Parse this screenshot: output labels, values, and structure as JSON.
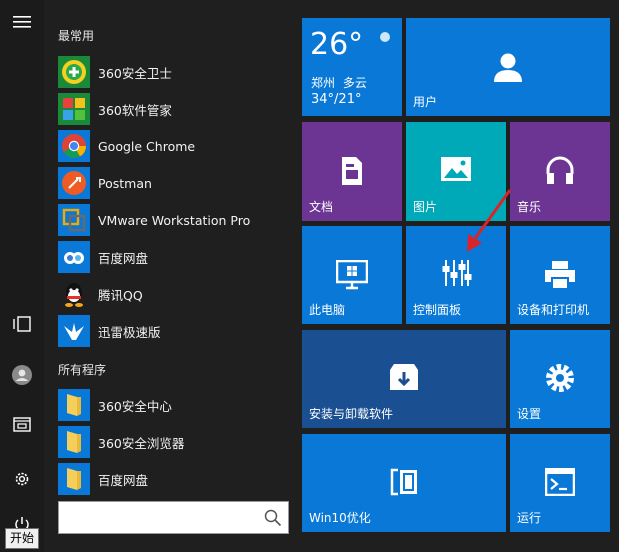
{
  "colors": {
    "background": "#1f1f1f",
    "tile_blue": "#0a78d7",
    "tile_purple": "#6c3493",
    "tile_teal": "#00a9b8",
    "tile_dark_blue": "#1a4f92",
    "arrow": "#d9242a"
  },
  "left_rail": {
    "items": [
      {
        "icon": "hamburger-menu-icon"
      },
      {
        "icon": "tablet-mode-icon"
      },
      {
        "icon": "user-avatar-icon"
      },
      {
        "icon": "documents-icon"
      },
      {
        "icon": "gear-icon"
      },
      {
        "icon": "power-icon"
      }
    ]
  },
  "sections": {
    "most_used": "最常用",
    "all_programs": "所有程序"
  },
  "most_used_apps": [
    {
      "name": "360安全卫士",
      "icon": "360-security-icon"
    },
    {
      "name": "360软件管家",
      "icon": "360-software-manager-icon"
    },
    {
      "name": "Google Chrome",
      "icon": "chrome-icon"
    },
    {
      "name": "Postman",
      "icon": "postman-icon"
    },
    {
      "name": "VMware Workstation Pro",
      "icon": "vmware-icon"
    },
    {
      "name": "百度网盘",
      "icon": "baidu-netdisk-icon"
    },
    {
      "name": "腾讯QQ",
      "icon": "qq-icon"
    },
    {
      "name": "迅雷极速版",
      "icon": "thunder-icon"
    }
  ],
  "all_programs_apps": [
    {
      "name": "360安全中心",
      "icon": "folder-icon"
    },
    {
      "name": "360安全浏览器",
      "icon": "folder-icon"
    },
    {
      "name": "百度网盘",
      "icon": "folder-icon"
    }
  ],
  "search": {
    "placeholder": "",
    "icon": "search-icon"
  },
  "tooltip": {
    "text": "开始"
  },
  "tiles": {
    "weather": {
      "temp": "26°",
      "city": "郑州",
      "condition": "多云",
      "range": "34°/21°"
    },
    "user": {
      "label": "用户",
      "icon": "user-icon"
    },
    "documents": {
      "label": "文档",
      "icon": "document-icon"
    },
    "pictures": {
      "label": "图片",
      "icon": "picture-icon"
    },
    "music": {
      "label": "音乐",
      "icon": "headphones-icon"
    },
    "this_pc": {
      "label": "此电脑",
      "icon": "monitor-icon"
    },
    "control_panel": {
      "label": "控制面板",
      "icon": "sliders-icon"
    },
    "devices_printers": {
      "label": "设备和打印机",
      "icon": "printer-icon"
    },
    "programs_features": {
      "label": "安装与卸载软件",
      "icon": "install-icon"
    },
    "settings": {
      "label": "设置",
      "icon": "gear-icon"
    },
    "win10_optimize": {
      "label": "Win10优化",
      "icon": "bracket-icon"
    },
    "run": {
      "label": "运行",
      "icon": "run-icon"
    }
  }
}
